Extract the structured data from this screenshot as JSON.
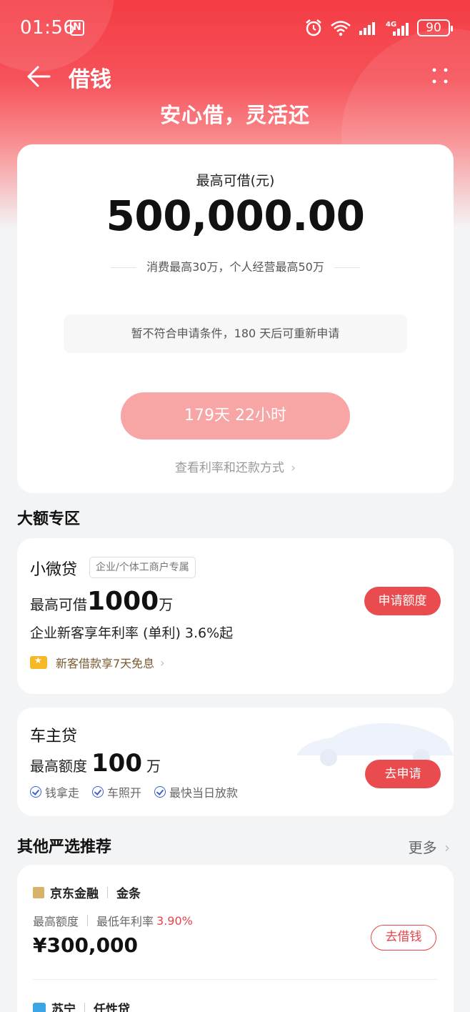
{
  "status": {
    "time": "01:56",
    "nfc": "N",
    "battery": "90",
    "network": "4G"
  },
  "nav": {
    "title": "借钱"
  },
  "slogan": "安心借，灵活还",
  "main": {
    "label": "最高可借(元)",
    "amount": "500,000.00",
    "note": "消费最高30万，个人经营最高50万",
    "warning": "暂不符合申请条件，180 天后可重新申请",
    "button": "179天 22小时",
    "link": "查看利率和还款方式"
  },
  "section_large": {
    "title": "大额专区"
  },
  "micro_loan": {
    "name": "小微贷",
    "tag": "企业/个体工商户专属",
    "max_prefix": "最高可借",
    "max_value": "1000",
    "max_unit": "万",
    "rate": "企业新客享年利率 (单利) 3.6%起",
    "promo": "新客借款享7天免息",
    "button": "申请额度"
  },
  "car_loan": {
    "name": "车主贷",
    "max_prefix": "最高额度",
    "max_value": "100",
    "max_unit": "万",
    "features": [
      "钱拿走",
      "车照开",
      "最快当日放款"
    ],
    "button": "去申请"
  },
  "recommend": {
    "title": "其他严选推荐",
    "more": "更多",
    "items": [
      {
        "brand": "京东金融",
        "product": "金条",
        "label_limit": "最高额度",
        "label_rate": "最低年利率",
        "rate": "3.90%",
        "amount": "¥300,000",
        "button": "去借钱"
      },
      {
        "brand": "苏宁",
        "product": "任性贷"
      }
    ]
  },
  "colors": {
    "primary": "#ea4b4e",
    "disabled_button": "#f7a5a5",
    "promo_text": "#7a5a30"
  }
}
